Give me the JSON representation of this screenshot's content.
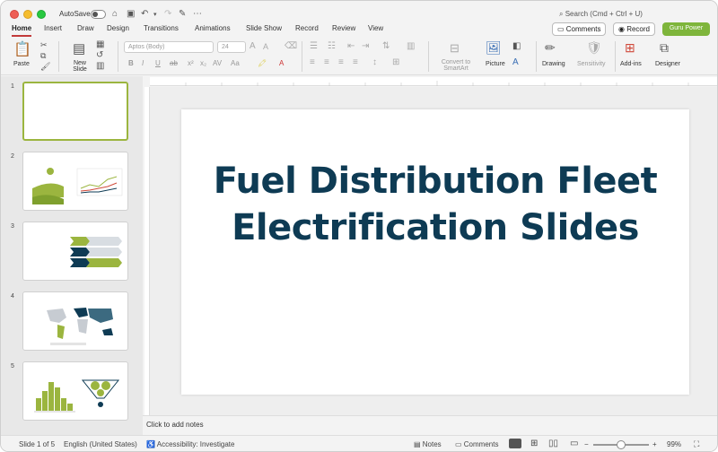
{
  "titlebar": {
    "autosave_label": "AutoSave",
    "search_placeholder": "Search (Cmd + Ctrl + U)"
  },
  "tabs": [
    "Home",
    "Insert",
    "Draw",
    "Design",
    "Transitions",
    "Animations",
    "Slide Show",
    "Record",
    "Review",
    "View"
  ],
  "actions": {
    "comments_label": "Comments",
    "record_label": "Record",
    "guru_label": "Guru Power",
    "guru_color": "#7eb53b"
  },
  "ribbon": {
    "paste": "Paste",
    "new_slide": "New Slide",
    "font_name": "Aptos (Body)",
    "font_size": "24",
    "convert_smartart": "Convert to SmartArt",
    "picture": "Picture",
    "drawing": "Drawing",
    "sensitivity": "Sensitivity",
    "addins": "Add-ins",
    "designer": "Designer"
  },
  "slides": {
    "numbers": [
      "1",
      "2",
      "3",
      "4",
      "5"
    ],
    "selected_index": 1,
    "selected_border_color": "#9bb53f"
  },
  "slide": {
    "title": "Fuel Distribution Fleet Electrification Slides",
    "title_color": "#0e3b54"
  },
  "notes": {
    "placeholder": "Click to add notes"
  },
  "status": {
    "slide_of": "Slide 1 of 5",
    "language": "English (United States)",
    "accessibility": "Accessibility: Investigate",
    "notes": "Notes",
    "comments": "Comments",
    "zoom": "99%"
  }
}
